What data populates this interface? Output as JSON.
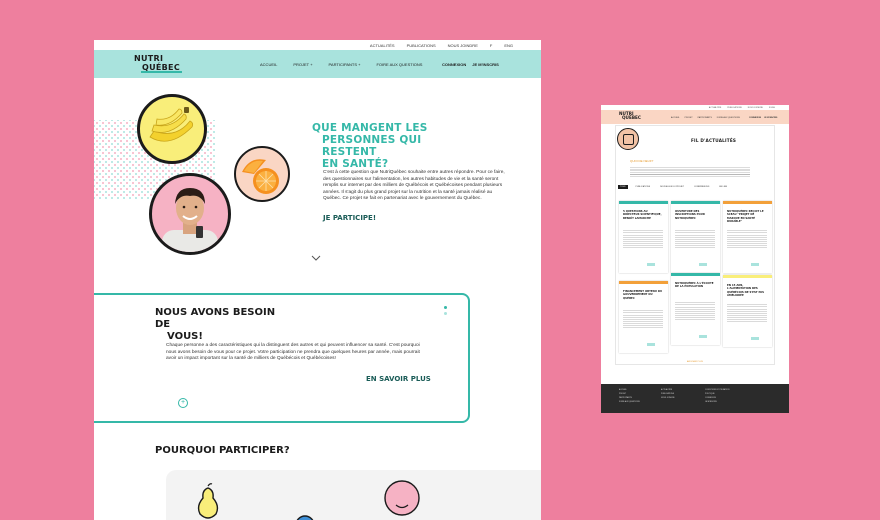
{
  "main": {
    "topbar": {
      "news": "ACTUALITÉS",
      "publications": "PUBLICATIONS",
      "contact": "NOUS JOINDRE",
      "lang_current": "F",
      "lang_other": "ENG"
    },
    "logo": {
      "line1": "NUTRI",
      "line2": "QUÉBEC"
    },
    "nav": {
      "home": "ACCUEIL",
      "project": "PROJET",
      "participants": "PARTICIPANTS",
      "faq": "FOIRE AUX QUESTIONS",
      "login": "CONNEXION",
      "signup": "JE M'INSCRIS"
    },
    "hero": {
      "title_1": "QUE MANGENT LES",
      "title_2": "PERSONNES QUI RESTENT",
      "title_3": "EN SANTÉ?",
      "text": "C'est à cette question que NutriQuébec souhaite entre autres répondre. Pour ce faire, des questionnaires sur l'alimentation, les autres habitudes de vie et la santé seront remplis sur internet par des milliers de Québécois et Québécoises pendant plusieurs années. Il s'agit du plus grand projet sur la nutrition et la santé jamais réalisé au Québec. Ce projet se fait en partenariat avec le gouvernement du Québec.",
      "cta": "JE PARTICIPE!"
    },
    "need": {
      "title_1": "NOUS AVONS BESOIN DE",
      "title_2": "VOUS!",
      "text": "Chaque personne a des caractéristiques qui la distinguent des autres et qui peuvent influencer sa santé. C'est pourquoi nous avons besoin de vous pour ce projet. Votre participation ne prendra que quelques heures par année, mais pourrait avoir un impact important sur la santé de milliers de Québécois et Québécoises!",
      "cta": "EN SAVOIR PLUS",
      "plus": "+"
    },
    "why": {
      "title": "POURQUOI PARTICIPER?"
    }
  },
  "mini": {
    "topbar": {
      "news": "ACTUALITÉS",
      "publications": "PUBLICATIONS",
      "contact": "NOUS JOINDRE",
      "lang": "F  ENG"
    },
    "logo": {
      "line1": "NUTRI",
      "line2": "QUÉBEC"
    },
    "nav": {
      "home": "ACCUEIL",
      "project": "PROJET",
      "participants": "PARTICIPANTS",
      "faq": "FOIRE AUX QUESTIONS",
      "login": "CONNEXION",
      "signup": "JE M'INSCRIS"
    },
    "title": "FIL D'ACTUALITÉS",
    "subtitle": "QUOI DE NEUF?",
    "filters": [
      "TOUS",
      "PUBLICATIONS",
      "NOUVELLES DU PROJET",
      "CONFÉRENCES",
      "EN LIEN"
    ],
    "cards": [
      {
        "title": "5 QUESTIONS AU DIRECTEUR SCIENTIFIQUE, BENOÎT LAMARCHE",
        "color": "#35b8a8"
      },
      {
        "title": "OUVERTURE DES INSCRIPTIONS POUR NUTRIQUÉBEC",
        "color": "#35b8a8"
      },
      {
        "title": "NUTRIQUÉBEC REÇOIT LE SCEAU \"PROJET DE MARQUE EN SANTÉ DURABLE\"",
        "color": "#f2a03a"
      },
      {
        "title": "FINANCEMENT OBTENU DU GOUVERNEMENT DU QUÉBEC",
        "color": "#f2a03a"
      },
      {
        "title": "NUTRIQUÉBEC À L'ÉCOUTE DE LA POPULATION",
        "color": "#35b8a8"
      },
      {
        "title": "EN 15 ANS, L'ALIMENTATION DES QUÉBÉCOIS NE S'EST PAS AMÉLIORÉE",
        "color": "#f9ee7a"
      }
    ],
    "more": "AFFICHER PLUS",
    "footer": {
      "col1": [
        "ACCUEIL",
        "PROJET",
        "PARTICIPANTS",
        "FOIRE AUX QUESTIONS"
      ],
      "col2": [
        "ACTUALITÉS",
        "PUBLICATIONS",
        "NOUS JOINDRE"
      ],
      "col3": [
        "CONDITIONS D'UTILISATION",
        "POLITIQUE",
        "CONNEXION",
        "JE M'INSCRIS"
      ]
    }
  },
  "colors": {
    "background": "#ee7f9e",
    "mint": "#a9e3dd",
    "teal": "#35b8a8",
    "peach": "#fad6c4",
    "yellow": "#f9ee7a",
    "pink": "#f6b2c4"
  }
}
